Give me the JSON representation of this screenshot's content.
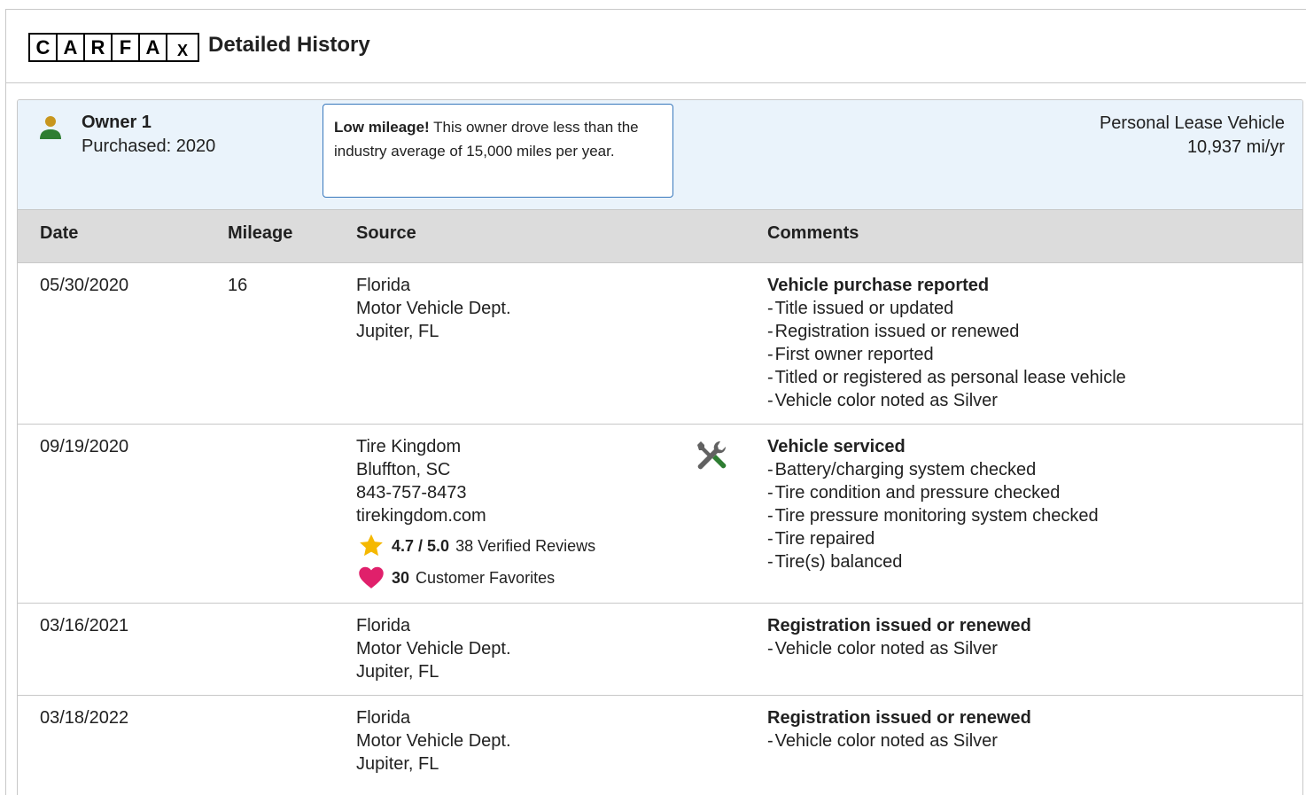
{
  "header": {
    "logo_letters": [
      "C",
      "A",
      "R",
      "F",
      "A",
      "X"
    ],
    "title": "Detailed History"
  },
  "owner": {
    "name": "Owner 1",
    "purchased": "Purchased: 2020",
    "callout_bold": "Low mileage!",
    "callout_text": " This owner drove less than the industry average of 15,000 miles per year.",
    "vehicle_type": "Personal Lease Vehicle",
    "miles_per_year": "10,937 mi/yr",
    "icon": "person-icon",
    "icon_colors": {
      "head": "#c8961e",
      "body": "#2e7d32"
    }
  },
  "table": {
    "columns": [
      "Date",
      "Mileage",
      "Source",
      "Comments"
    ],
    "rows": [
      {
        "date": "05/30/2020",
        "mileage": "16",
        "source": [
          "Florida",
          "Motor Vehicle Dept.",
          "Jupiter, FL"
        ],
        "comment_head": "Vehicle purchase reported",
        "comments": [
          "Title issued or updated",
          "Registration issued or renewed",
          "First owner reported",
          "Titled or registered as personal lease vehicle",
          "Vehicle color noted as Silver"
        ]
      },
      {
        "date": "09/19/2020",
        "mileage": "",
        "source": [
          "Tire Kingdom",
          "Bluffton, SC",
          "843-757-8473",
          "tirekingdom.com"
        ],
        "rating_value": "4.7 / 5.0",
        "rating_text": "38 Verified Reviews",
        "favorites_count": "30",
        "favorites_text": "Customer Favorites",
        "service_icon": "wrench-screwdriver-icon",
        "comment_head": "Vehicle serviced",
        "comments": [
          "Battery/charging system checked",
          "Tire condition and pressure checked",
          "Tire pressure monitoring system checked",
          "Tire repaired",
          "Tire(s) balanced"
        ]
      },
      {
        "date": "03/16/2021",
        "mileage": "",
        "source": [
          "Florida",
          "Motor Vehicle Dept.",
          "Jupiter, FL"
        ],
        "comment_head": "Registration issued or renewed",
        "comments": [
          "Vehicle color noted as Silver"
        ]
      },
      {
        "date": "03/18/2022",
        "mileage": "",
        "source": [
          "Florida",
          "Motor Vehicle Dept.",
          "Jupiter, FL"
        ],
        "comment_head": "Registration issued or renewed",
        "comments": [
          "Vehicle color noted as Silver"
        ]
      }
    ]
  },
  "colors": {
    "owner_bar_bg": "#eaf3fb",
    "callout_border": "#3777bc",
    "header_row_bg": "#dcdcdc",
    "star": "#f5b800",
    "heart": "#e0206b",
    "service_icon_green": "#2e7d32"
  }
}
